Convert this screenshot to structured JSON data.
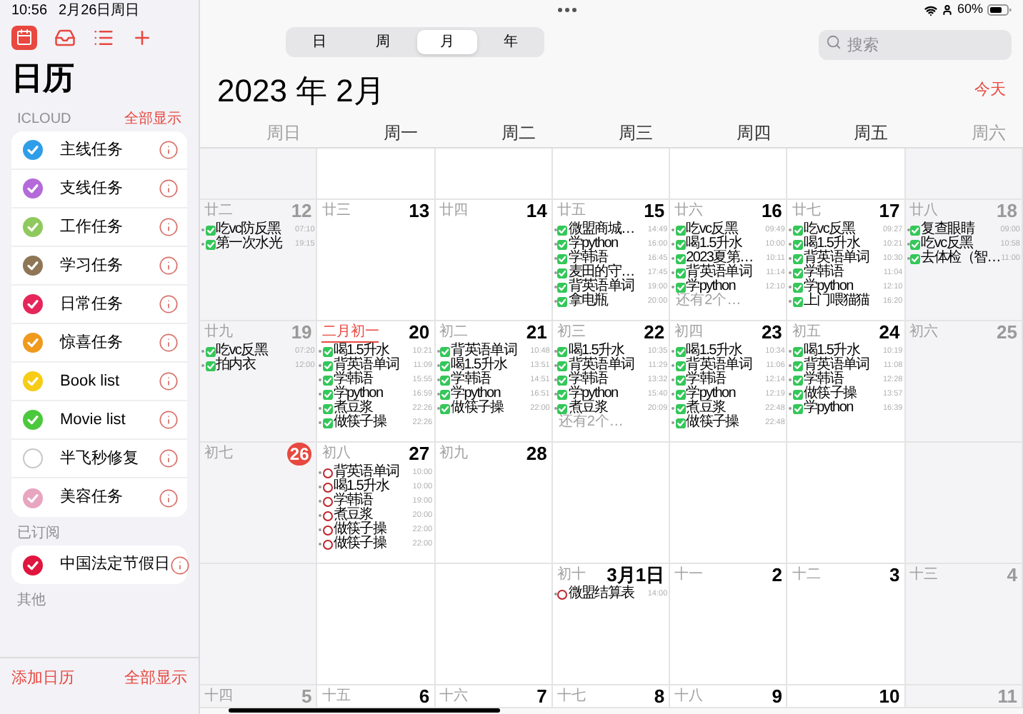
{
  "status_bar": {
    "time": "10:56",
    "date": "2月26日周日",
    "battery": "60%"
  },
  "sidebar": {
    "title": "日历",
    "sections": [
      {
        "header": "ICLOUD",
        "action": "全部显示",
        "calendars": [
          {
            "name": "主线任务",
            "color": "#2f9ee8",
            "checked": true
          },
          {
            "name": "支线任务",
            "color": "#b56ad9",
            "checked": true
          },
          {
            "name": "工作任务",
            "color": "#8fc95d",
            "checked": true
          },
          {
            "name": "学习任务",
            "color": "#8e7657",
            "checked": true
          },
          {
            "name": "日常任务",
            "color": "#e6265b",
            "checked": true
          },
          {
            "name": "惊喜任务",
            "color": "#f09a1d",
            "checked": true
          },
          {
            "name": "Book list",
            "color": "#f6cc16",
            "checked": true
          },
          {
            "name": "Movie list",
            "color": "#4cc83d",
            "checked": true
          },
          {
            "name": "半飞秒修复",
            "color": "#c7c7cc",
            "checked": false
          },
          {
            "name": "美容任务",
            "color": "#e8a5c0",
            "checked": true
          }
        ]
      },
      {
        "header": "已订阅",
        "calendars": [
          {
            "name": "中国法定节假日",
            "color": "#e0163e",
            "checked": true
          }
        ]
      },
      {
        "header": "其他"
      }
    ],
    "footer": {
      "add": "添加日历",
      "show_all": "全部显示"
    }
  },
  "view_tabs": [
    {
      "label": "日",
      "selected": false
    },
    {
      "label": "周",
      "selected": false
    },
    {
      "label": "月",
      "selected": true
    },
    {
      "label": "年",
      "selected": false
    }
  ],
  "search": {
    "placeholder": "搜索"
  },
  "month_title": "2023 年 2月",
  "today_button": "今天",
  "weekdays": [
    "周日",
    "周一",
    "周二",
    "周三",
    "周四",
    "周五",
    "周六"
  ],
  "weeks": [
    {
      "kind": "full",
      "days": [
        {
          "lunar": "廿二",
          "day": "12",
          "today": false,
          "events": [
            {
              "title": "吃vc防反黑",
              "time": "07:10",
              "done": true
            },
            {
              "title": "第一次水光",
              "time": "19:15",
              "done": true
            }
          ]
        },
        {
          "lunar": "廿三",
          "day": "13",
          "today": false
        },
        {
          "lunar": "廿四",
          "day": "14",
          "today": false
        },
        {
          "lunar": "廿五",
          "day": "15",
          "today": false,
          "events": [
            {
              "title": "微盟商城…",
              "time": "14:49",
              "done": true
            },
            {
              "title": "学python",
              "time": "16:00",
              "done": true
            },
            {
              "title": "学韩语",
              "time": "16:45",
              "done": true
            },
            {
              "title": "麦田的守…",
              "time": "17:45",
              "done": true
            },
            {
              "title": "背英语单词",
              "time": "19:00",
              "done": true
            },
            {
              "title": "拿电瓶",
              "time": "20:00",
              "done": true
            }
          ]
        },
        {
          "lunar": "廿六",
          "day": "16",
          "today": false,
          "events": [
            {
              "title": "吃vc反黑",
              "time": "09:49",
              "done": true
            },
            {
              "title": "喝1.5升水",
              "time": "10:00",
              "done": true
            },
            {
              "title": "2023夏第…",
              "time": "10:11",
              "done": true
            },
            {
              "title": "背英语单词",
              "time": "11:14",
              "done": true
            },
            {
              "title": "学python",
              "time": "12:10",
              "done": true
            }
          ],
          "more": "还有2个…"
        },
        {
          "lunar": "廿七",
          "day": "17",
          "today": false,
          "events": [
            {
              "title": "吃vc反黑",
              "time": "09:27",
              "done": true
            },
            {
              "title": "喝1.5升水",
              "time": "10:21",
              "done": true
            },
            {
              "title": "背英语单词",
              "time": "10:30",
              "done": true
            },
            {
              "title": "学韩语",
              "time": "11:04",
              "done": true
            },
            {
              "title": "学python",
              "time": "12:10",
              "done": true
            },
            {
              "title": "上门喂猫猫",
              "time": "16:20",
              "done": true
            }
          ]
        },
        {
          "lunar": "廿八",
          "day": "18",
          "today": false,
          "events": [
            {
              "title": "复查眼睛",
              "time": "09:00",
              "done": true
            },
            {
              "title": "吃vc反黑",
              "time": "10:58",
              "done": true
            },
            {
              "title": "去体检（智…",
              "time": "11:00",
              "done": true
            }
          ]
        }
      ]
    },
    {
      "kind": "full",
      "days": [
        {
          "lunar": "廿九",
          "day": "19",
          "today": false,
          "events": [
            {
              "title": "吃vc反黑",
              "time": "07:20",
              "done": true
            },
            {
              "title": "拍内衣",
              "time": "12:00",
              "done": true
            }
          ]
        },
        {
          "lunar": "二月初一",
          "day": "20",
          "today": false,
          "marked": true,
          "events": [
            {
              "title": "喝1.5升水",
              "time": "10:21",
              "done": true
            },
            {
              "title": "背英语单词",
              "time": "11:09",
              "done": true
            },
            {
              "title": "学韩语",
              "time": "15:55",
              "done": true
            },
            {
              "title": "学python",
              "time": "16:59",
              "done": true
            },
            {
              "title": "煮豆浆",
              "time": "22:26",
              "done": true
            },
            {
              "title": "做筷子操",
              "time": "22:26",
              "done": true
            }
          ]
        },
        {
          "lunar": "初二",
          "day": "21",
          "today": false,
          "events": [
            {
              "title": "背英语单词",
              "time": "10:48",
              "done": true
            },
            {
              "title": "喝1.5升水",
              "time": "13:51",
              "done": true
            },
            {
              "title": "学韩语",
              "time": "14:51",
              "done": true
            },
            {
              "title": "学python",
              "time": "16:51",
              "done": true
            },
            {
              "title": "做筷子操",
              "time": "22:00",
              "done": true
            }
          ]
        },
        {
          "lunar": "初三",
          "day": "22",
          "today": false,
          "events": [
            {
              "title": "喝1.5升水",
              "time": "10:35",
              "done": true
            },
            {
              "title": "背英语单词",
              "time": "11:29",
              "done": true
            },
            {
              "title": "学韩语",
              "time": "13:32",
              "done": true
            },
            {
              "title": "学python",
              "time": "15:40",
              "done": true
            },
            {
              "title": "煮豆浆",
              "time": "20:09",
              "done": true
            }
          ],
          "more": "还有2个…"
        },
        {
          "lunar": "初四",
          "day": "23",
          "today": false,
          "events": [
            {
              "title": "喝1.5升水",
              "time": "10:34",
              "done": true
            },
            {
              "title": "背英语单词",
              "time": "11:06",
              "done": true
            },
            {
              "title": "学韩语",
              "time": "12:14",
              "done": true
            },
            {
              "title": "学python",
              "time": "12:19",
              "done": true
            },
            {
              "title": "煮豆浆",
              "time": "22:48",
              "done": true
            },
            {
              "title": "做筷子操",
              "time": "22:48",
              "done": true
            }
          ]
        },
        {
          "lunar": "初五",
          "day": "24",
          "today": false,
          "events": [
            {
              "title": "喝1.5升水",
              "time": "10:19",
              "done": true
            },
            {
              "title": "背英语单词",
              "time": "11:08",
              "done": true
            },
            {
              "title": "学韩语",
              "time": "12:28",
              "done": true
            },
            {
              "title": "做筷子操",
              "time": "13:57",
              "done": true
            },
            {
              "title": "学python",
              "time": "16:39",
              "done": true
            }
          ]
        },
        {
          "lunar": "初六",
          "day": "25",
          "today": false
        }
      ]
    },
    {
      "kind": "month_end",
      "days": [
        {
          "lunar": "初七",
          "day": "26",
          "today": true
        },
        {
          "lunar": "初八",
          "day": "27",
          "today": false,
          "events": [
            {
              "title": "背英语单词",
              "time": "10:00",
              "done": false
            },
            {
              "title": "喝1.5升水",
              "time": "10:00",
              "done": false
            },
            {
              "title": "学韩语",
              "time": "19:00",
              "done": false
            },
            {
              "title": "煮豆浆",
              "time": "20:00",
              "done": false
            },
            {
              "title": "做筷子操",
              "time": "22:00",
              "done": false
            },
            {
              "title": "做筷子操",
              "time": "22:00",
              "done": false
            }
          ]
        },
        {
          "lunar": "初九",
          "day": "28",
          "today": false
        }
      ]
    },
    {
      "kind": "month_start",
      "days": [
        {
          "lunar": "初十",
          "day": "3月1日",
          "today": false,
          "events": [
            {
              "title": "微盟结算表",
              "time": "14:00",
              "done": false
            }
          ]
        },
        {
          "lunar": "十一",
          "day": "2",
          "today": false
        },
        {
          "lunar": "十二",
          "day": "3",
          "today": false
        },
        {
          "lunar": "十三",
          "day": "4",
          "today": false
        }
      ]
    },
    {
      "kind": "full",
      "days": [
        {
          "lunar": "十四",
          "day": "5",
          "today": false
        },
        {
          "lunar": "十五",
          "day": "6",
          "today": false
        },
        {
          "lunar": "十六",
          "day": "7",
          "today": false
        },
        {
          "lunar": "十七",
          "day": "8",
          "today": false
        },
        {
          "lunar": "十八",
          "day": "9",
          "today": false
        },
        {
          "day": "10",
          "today": false
        },
        {
          "day": "11",
          "today": false
        }
      ]
    }
  ]
}
